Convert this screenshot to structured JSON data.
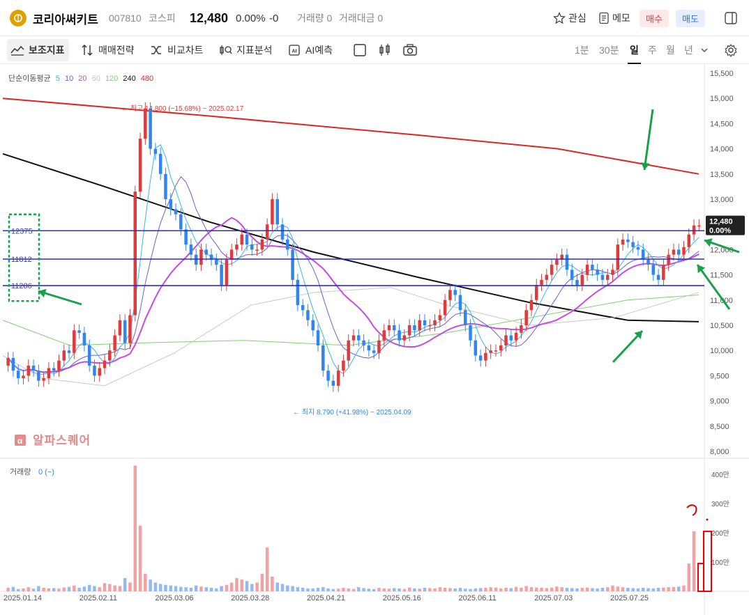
{
  "header": {
    "logo_icon": "stock-logo-icon",
    "name": "코리아써키트",
    "code": "007810",
    "market": "코스피",
    "price": "12,480",
    "change_pct": "0.00%",
    "change": "-0",
    "volume_label": "거래량 0",
    "amount_label": "거래대금 0",
    "watch_label": "관심",
    "memo_label": "메모",
    "buy_label": "매수",
    "sell_label": "매도"
  },
  "toolbar": {
    "items": [
      "보조지표",
      "매매전략",
      "비교차트",
      "지표분석",
      "AI예측"
    ],
    "periods": [
      "1분",
      "30분",
      "일",
      "주",
      "월",
      "년"
    ],
    "active_period": "일"
  },
  "chart_data": {
    "type": "candlestick",
    "title": "",
    "ma_legend_label": "단순이동평균",
    "ma_periods": [
      "5",
      "10",
      "20",
      "60",
      "120",
      "240",
      "480"
    ],
    "ma_colors": [
      "#38b6e8",
      "#6a5cdb",
      "#c64be0",
      "#c9c9c9",
      "#7ad36b",
      "#111111",
      "#e02424"
    ],
    "ylim": [
      8000,
      15500
    ],
    "y_ticks": [
      "15,500",
      "15,000",
      "14,500",
      "14,000",
      "13,500",
      "13,000",
      "12,500",
      "12,000",
      "11,500",
      "11,000",
      "10,500",
      "10,000",
      "9,500",
      "9,000",
      "8,500",
      "8,000"
    ],
    "x_dates": [
      "2025.01.14",
      "2025.02.11",
      "2025.03.06",
      "2025.03.28",
      "2025.04.21",
      "2025.05.16",
      "2025.06.11",
      "2025.07.03",
      "2025.07.25"
    ],
    "current_price_label": "12,480",
    "current_change_label": "0.00%",
    "high_annotation": "← 최고 14,800 (−15.68%) − 2025.02.17",
    "low_annotation": "← 최지 8,790 (+41.98%) − 2025.04.09",
    "watermark": "알파스퀘어",
    "horizontal_levels": [
      {
        "label": "12375",
        "value": 12375
      },
      {
        "label": "11812",
        "value": 11812
      },
      {
        "label": "11286",
        "value": 11286
      }
    ],
    "ma_colors_note": "",
    "up_color": "#e03a3a",
    "down_color": "#2f86f0",
    "level_color": "#2b2bd8",
    "candles_close": [
      9850,
      9600,
      9450,
      9500,
      9700,
      9600,
      9400,
      9450,
      9650,
      9600,
      9800,
      10000,
      9950,
      10400,
      10350,
      10100,
      9700,
      9500,
      9650,
      9800,
      10000,
      10300,
      10600,
      10150,
      10700,
      13150,
      14200,
      14800,
      14000,
      13900,
      13500,
      13000,
      12800,
      12700,
      12400,
      12100,
      11900,
      11700,
      12000,
      11900,
      11800,
      11700,
      11300,
      11800,
      12000,
      12100,
      12300,
      12100,
      12000,
      12000,
      12200,
      12500,
      13000,
      12500,
      12200,
      12000,
      11400,
      10900,
      10800,
      10600,
      10400,
      10100,
      9600,
      9400,
      9300,
      9600,
      9800,
      10200,
      10300,
      10200,
      10100,
      10000,
      9950,
      10200,
      10400,
      10500,
      10400,
      10200,
      10300,
      10500,
      10400,
      10600,
      10500,
      10500,
      10600,
      10700,
      11000,
      11200,
      11100,
      10800,
      10500,
      10200,
      9900,
      9800,
      9950,
      10000,
      10000,
      10100,
      10300,
      10200,
      10350,
      10500,
      10800,
      11000,
      11300,
      11400,
      11500,
      11700,
      11800,
      11900,
      11600,
      11400,
      11300,
      11500,
      11700,
      11600,
      11500,
      11400,
      11500,
      11600,
      12100,
      12200,
      12150,
      12050,
      12000,
      11800,
      11700,
      11500,
      11400,
      11700,
      11900,
      12000,
      11900,
      12050,
      12300,
      12480,
      12480
    ],
    "volume_unit_ticks": [
      "400만",
      "300만",
      "200만",
      "100만"
    ],
    "volume_ylim": [
      0,
      450
    ],
    "volume_values": [
      12,
      15,
      8,
      10,
      14,
      9,
      18,
      12,
      10,
      11,
      9,
      13,
      15,
      20,
      12,
      16,
      22,
      18,
      14,
      28,
      25,
      20,
      18,
      45,
      30,
      430,
      225,
      60,
      40,
      30,
      25,
      22,
      20,
      18,
      15,
      14,
      12,
      20,
      16,
      14,
      12,
      10,
      18,
      22,
      30,
      45,
      40,
      35,
      25,
      30,
      60,
      150,
      50,
      30,
      25,
      20,
      18,
      14,
      12,
      10,
      10,
      12,
      14,
      10,
      8,
      9,
      12,
      10,
      8,
      14,
      11,
      9,
      8,
      12,
      10,
      9,
      11,
      10,
      8,
      13,
      10,
      9,
      12,
      11,
      10,
      14,
      12,
      11,
      10,
      12,
      9,
      8,
      10,
      11,
      12,
      14,
      13,
      10,
      12,
      11,
      15,
      12,
      18,
      14,
      13,
      12,
      11,
      13,
      16,
      14,
      12,
      11,
      10,
      12,
      13,
      11,
      10,
      12,
      14,
      20,
      16,
      14,
      12,
      11,
      10,
      12,
      11,
      10,
      12,
      13,
      14,
      15,
      16,
      20,
      95,
      205,
      0
    ],
    "volume_label": "거래량",
    "volume_value_label": "0 (−)"
  }
}
